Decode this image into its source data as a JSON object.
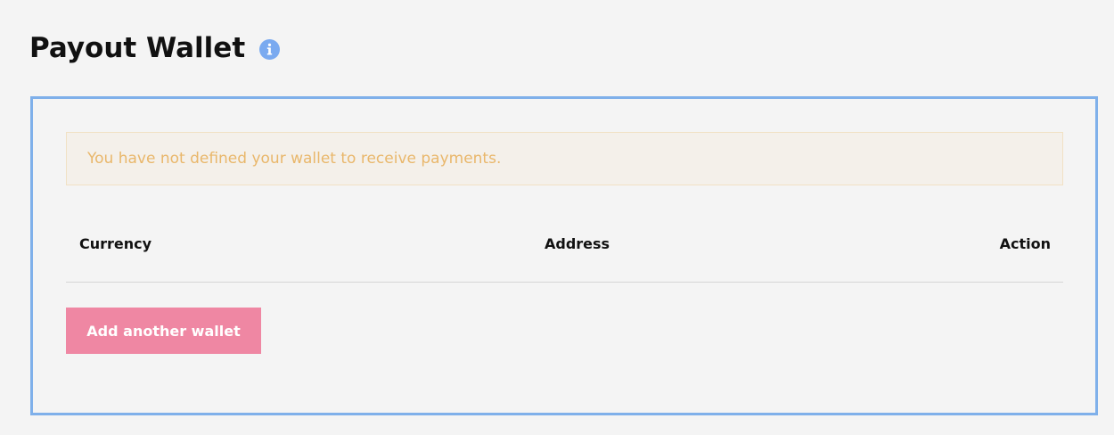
{
  "header": {
    "title": "Payout Wallet",
    "info_icon": "info-icon"
  },
  "alert": {
    "message": "You have not defined your wallet to receive payments."
  },
  "table": {
    "columns": [
      "Currency",
      "Address",
      "Action"
    ],
    "rows": []
  },
  "actions": {
    "add_wallet_label": "Add another wallet"
  },
  "colors": {
    "border": "#7fb0ea",
    "alert_text": "#e9b76b",
    "alert_bg": "#f4f0ea",
    "button_bg": "#ef87a3",
    "info_icon": "#7aaaf0"
  }
}
